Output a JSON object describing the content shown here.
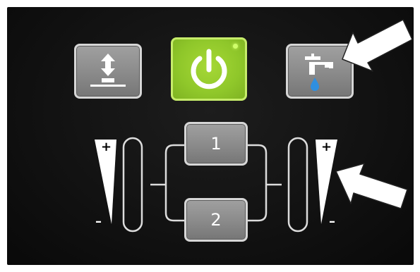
{
  "zones": {
    "left": {
      "plus": "+",
      "minus": "–"
    },
    "right": {
      "plus": "+",
      "minus": "–"
    }
  },
  "buttons": {
    "zone_1": "1",
    "zone_2": "2"
  },
  "colors": {
    "power_green": "#8fc72a",
    "button_grey": "#8a8a8a",
    "water_drop": "#2f8fe0",
    "panel": "#111111"
  },
  "icons": {
    "left_button": "height-adjust-icon",
    "power_button": "power-icon",
    "right_button": "faucet-water-icon"
  }
}
